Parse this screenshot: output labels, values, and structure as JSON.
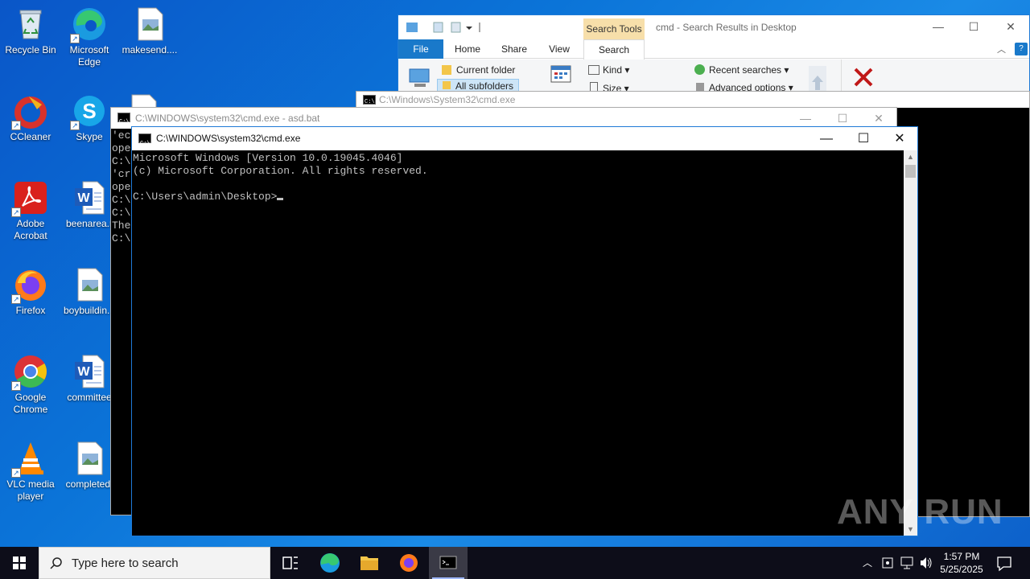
{
  "desktop": {
    "icons": [
      {
        "label": "Recycle Bin"
      },
      {
        "label": "Microsoft Edge"
      },
      {
        "label": "makesend...."
      },
      {
        "label": "CCleaner"
      },
      {
        "label": "Skype"
      },
      {
        "label": "Adobe Acrobat"
      },
      {
        "label": "beenarea.r"
      },
      {
        "label": "Firefox"
      },
      {
        "label": "boybuildin..."
      },
      {
        "label": "Google Chrome"
      },
      {
        "label": "committee"
      },
      {
        "label": "VLC media player"
      },
      {
        "label": "completed."
      }
    ]
  },
  "explorer": {
    "title": "cmd - Search Results in Desktop",
    "context_tab": "Search Tools",
    "tabs": [
      "File",
      "Home",
      "Share",
      "View",
      "Search"
    ],
    "ribbon": {
      "current_folder": "Current folder",
      "all_subfolders": "All subfolders",
      "kind": "Kind",
      "size": "Size",
      "recent_searches": "Recent searches",
      "advanced_options": "Advanced options"
    }
  },
  "cmd_back1": {
    "title": "C:\\Windows\\System32\\cmd.exe"
  },
  "cmd_back2": {
    "title": "C:\\WINDOWS\\system32\\cmd.exe - asd.bat",
    "lines": [
      "'ec",
      "ope",
      "",
      "C:\\",
      "'cr",
      "ope",
      "",
      "C:\\",
      "",
      "C:\\",
      "The",
      "",
      "C:\\"
    ]
  },
  "cmd_main": {
    "title": "C:\\WINDOWS\\system32\\cmd.exe",
    "line1": "Microsoft Windows [Version 10.0.19045.4046]",
    "line2": "(c) Microsoft Corporation. All rights reserved.",
    "prompt": "C:\\Users\\admin\\Desktop>"
  },
  "watermark": "ANY RUN",
  "taskbar": {
    "search_placeholder": "Type here to search",
    "time": "1:57 PM",
    "date": "5/25/2025"
  },
  "colors": {
    "taskbar": "#0d0d19",
    "accent": "#1979ca",
    "console_bg": "#000000",
    "console_text": "#c0c0c0"
  }
}
